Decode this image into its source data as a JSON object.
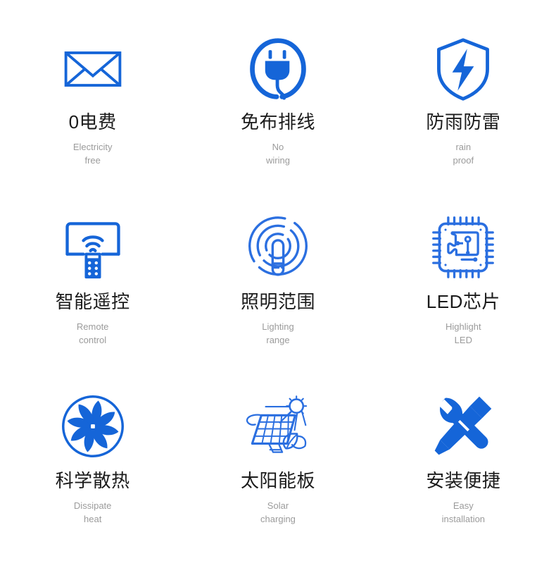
{
  "theme": {
    "accent_blue": "#1565d8",
    "title_color": "#1b1b1b",
    "subtitle_color": "#9b9b9b",
    "background": "#ffffff"
  },
  "features": [
    {
      "icon": "envelope-icon",
      "title": "0电费",
      "sub_line1": "Electricity",
      "sub_line2": "free"
    },
    {
      "icon": "power-plug-icon",
      "title": "免布排线",
      "sub_line1": "No",
      "sub_line2": "wiring"
    },
    {
      "icon": "shield-lightning-icon",
      "title": "防雨防雷",
      "sub_line1": "rain",
      "sub_line2": "proof"
    },
    {
      "icon": "remote-control-icon",
      "title": "智能遥控",
      "sub_line1": "Remote",
      "sub_line2": "control"
    },
    {
      "icon": "lighting-range-icon",
      "title": "照明范围",
      "sub_line1": "Lighting",
      "sub_line2": "range"
    },
    {
      "icon": "led-chip-icon",
      "title": "LED芯片",
      "sub_line1": "Highlight",
      "sub_line2": "LED"
    },
    {
      "icon": "cooling-fan-icon",
      "title": "科学散热",
      "sub_line1": "Dissipate",
      "sub_line2": "heat"
    },
    {
      "icon": "solar-panel-icon",
      "title": "太阳能板",
      "sub_line1": "Solar",
      "sub_line2": "charging"
    },
    {
      "icon": "wrench-screwdriver-icon",
      "title": "安装便捷",
      "sub_line1": "Easy",
      "sub_line2": "installation"
    }
  ]
}
